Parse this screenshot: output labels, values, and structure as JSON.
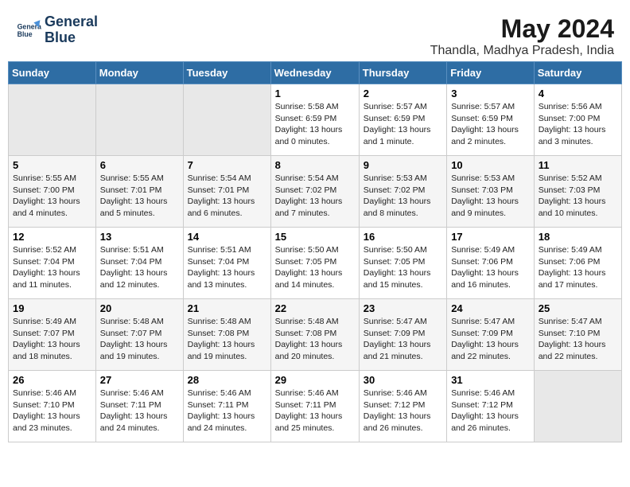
{
  "logo": {
    "line1": "General",
    "line2": "Blue"
  },
  "title": "May 2024",
  "location": "Thandla, Madhya Pradesh, India",
  "headers": [
    "Sunday",
    "Monday",
    "Tuesday",
    "Wednesday",
    "Thursday",
    "Friday",
    "Saturday"
  ],
  "weeks": [
    [
      {
        "day": "",
        "info": ""
      },
      {
        "day": "",
        "info": ""
      },
      {
        "day": "",
        "info": ""
      },
      {
        "day": "1",
        "info": "Sunrise: 5:58 AM\nSunset: 6:59 PM\nDaylight: 13 hours\nand 0 minutes."
      },
      {
        "day": "2",
        "info": "Sunrise: 5:57 AM\nSunset: 6:59 PM\nDaylight: 13 hours\nand 1 minute."
      },
      {
        "day": "3",
        "info": "Sunrise: 5:57 AM\nSunset: 6:59 PM\nDaylight: 13 hours\nand 2 minutes."
      },
      {
        "day": "4",
        "info": "Sunrise: 5:56 AM\nSunset: 7:00 PM\nDaylight: 13 hours\nand 3 minutes."
      }
    ],
    [
      {
        "day": "5",
        "info": "Sunrise: 5:55 AM\nSunset: 7:00 PM\nDaylight: 13 hours\nand 4 minutes."
      },
      {
        "day": "6",
        "info": "Sunrise: 5:55 AM\nSunset: 7:01 PM\nDaylight: 13 hours\nand 5 minutes."
      },
      {
        "day": "7",
        "info": "Sunrise: 5:54 AM\nSunset: 7:01 PM\nDaylight: 13 hours\nand 6 minutes."
      },
      {
        "day": "8",
        "info": "Sunrise: 5:54 AM\nSunset: 7:02 PM\nDaylight: 13 hours\nand 7 minutes."
      },
      {
        "day": "9",
        "info": "Sunrise: 5:53 AM\nSunset: 7:02 PM\nDaylight: 13 hours\nand 8 minutes."
      },
      {
        "day": "10",
        "info": "Sunrise: 5:53 AM\nSunset: 7:03 PM\nDaylight: 13 hours\nand 9 minutes."
      },
      {
        "day": "11",
        "info": "Sunrise: 5:52 AM\nSunset: 7:03 PM\nDaylight: 13 hours\nand 10 minutes."
      }
    ],
    [
      {
        "day": "12",
        "info": "Sunrise: 5:52 AM\nSunset: 7:04 PM\nDaylight: 13 hours\nand 11 minutes."
      },
      {
        "day": "13",
        "info": "Sunrise: 5:51 AM\nSunset: 7:04 PM\nDaylight: 13 hours\nand 12 minutes."
      },
      {
        "day": "14",
        "info": "Sunrise: 5:51 AM\nSunset: 7:04 PM\nDaylight: 13 hours\nand 13 minutes."
      },
      {
        "day": "15",
        "info": "Sunrise: 5:50 AM\nSunset: 7:05 PM\nDaylight: 13 hours\nand 14 minutes."
      },
      {
        "day": "16",
        "info": "Sunrise: 5:50 AM\nSunset: 7:05 PM\nDaylight: 13 hours\nand 15 minutes."
      },
      {
        "day": "17",
        "info": "Sunrise: 5:49 AM\nSunset: 7:06 PM\nDaylight: 13 hours\nand 16 minutes."
      },
      {
        "day": "18",
        "info": "Sunrise: 5:49 AM\nSunset: 7:06 PM\nDaylight: 13 hours\nand 17 minutes."
      }
    ],
    [
      {
        "day": "19",
        "info": "Sunrise: 5:49 AM\nSunset: 7:07 PM\nDaylight: 13 hours\nand 18 minutes."
      },
      {
        "day": "20",
        "info": "Sunrise: 5:48 AM\nSunset: 7:07 PM\nDaylight: 13 hours\nand 19 minutes."
      },
      {
        "day": "21",
        "info": "Sunrise: 5:48 AM\nSunset: 7:08 PM\nDaylight: 13 hours\nand 19 minutes."
      },
      {
        "day": "22",
        "info": "Sunrise: 5:48 AM\nSunset: 7:08 PM\nDaylight: 13 hours\nand 20 minutes."
      },
      {
        "day": "23",
        "info": "Sunrise: 5:47 AM\nSunset: 7:09 PM\nDaylight: 13 hours\nand 21 minutes."
      },
      {
        "day": "24",
        "info": "Sunrise: 5:47 AM\nSunset: 7:09 PM\nDaylight: 13 hours\nand 22 minutes."
      },
      {
        "day": "25",
        "info": "Sunrise: 5:47 AM\nSunset: 7:10 PM\nDaylight: 13 hours\nand 22 minutes."
      }
    ],
    [
      {
        "day": "26",
        "info": "Sunrise: 5:46 AM\nSunset: 7:10 PM\nDaylight: 13 hours\nand 23 minutes."
      },
      {
        "day": "27",
        "info": "Sunrise: 5:46 AM\nSunset: 7:11 PM\nDaylight: 13 hours\nand 24 minutes."
      },
      {
        "day": "28",
        "info": "Sunrise: 5:46 AM\nSunset: 7:11 PM\nDaylight: 13 hours\nand 24 minutes."
      },
      {
        "day": "29",
        "info": "Sunrise: 5:46 AM\nSunset: 7:11 PM\nDaylight: 13 hours\nand 25 minutes."
      },
      {
        "day": "30",
        "info": "Sunrise: 5:46 AM\nSunset: 7:12 PM\nDaylight: 13 hours\nand 26 minutes."
      },
      {
        "day": "31",
        "info": "Sunrise: 5:46 AM\nSunset: 7:12 PM\nDaylight: 13 hours\nand 26 minutes."
      },
      {
        "day": "",
        "info": ""
      }
    ]
  ]
}
